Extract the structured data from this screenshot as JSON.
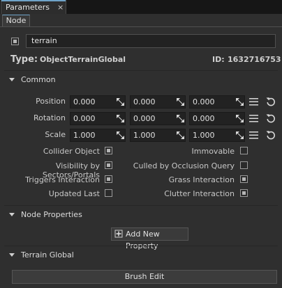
{
  "tabs": {
    "parameters_label": "Parameters",
    "parameters_close": "×"
  },
  "subtabs": {
    "node_label": "Node"
  },
  "node": {
    "enabled": true,
    "name": "terrain",
    "type_label": "Type:",
    "type_value": "ObjectTerrainGlobal",
    "id_label": "ID:",
    "id_value": "1632716753"
  },
  "common": {
    "title": "Common",
    "transform": [
      {
        "label": "Position",
        "values": [
          "0.000",
          "0.000",
          "0.000"
        ]
      },
      {
        "label": "Rotation",
        "values": [
          "0.000",
          "0.000",
          "0.000"
        ]
      },
      {
        "label": "Scale",
        "values": [
          "1.000",
          "1.000",
          "1.000"
        ]
      }
    ],
    "flags_left": [
      {
        "label": "Collider Object",
        "checked": true
      },
      {
        "label": "Visibility by Sectors/Portals",
        "checked": true
      },
      {
        "label": "Triggers Interaction",
        "checked": true
      },
      {
        "label": "Updated Last",
        "checked": false
      }
    ],
    "flags_right": [
      {
        "label": "Immovable",
        "checked": false
      },
      {
        "label": "Culled by Occlusion Query",
        "checked": false
      },
      {
        "label": "Grass Interaction",
        "checked": true
      },
      {
        "label": "Clutter Interaction",
        "checked": true
      }
    ]
  },
  "node_properties": {
    "title": "Node Properties",
    "add_button_label": "Add New Property"
  },
  "terrain_global": {
    "title": "Terrain Global",
    "brush_button_label": "Brush Edit"
  },
  "colors": {
    "accent": "#6fa3c8",
    "panel_bg": "#2f2f2f",
    "field_bg": "#222222"
  }
}
